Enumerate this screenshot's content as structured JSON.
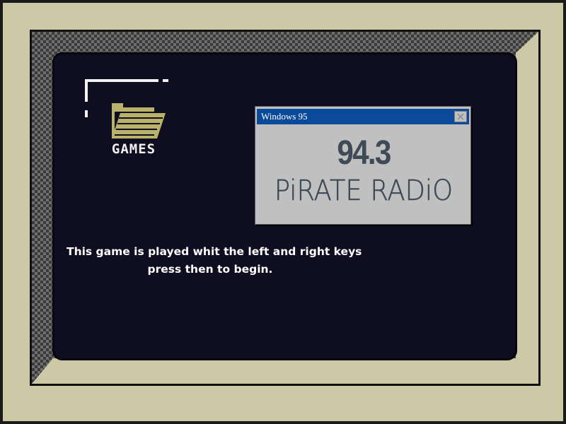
{
  "desktop": {
    "games_label": "GAMES",
    "folder_icon": "folder-icon",
    "folder_color": "#b9b26b"
  },
  "dialog": {
    "title": "Windows 95",
    "close_icon": "close-icon",
    "frequency": "94.3",
    "station_name": "PiRATE RADiO"
  },
  "instructions": {
    "line1": "This game is played whit the left and right keys",
    "line2": "press then to begin."
  },
  "colors": {
    "frame": "#cdc8a5",
    "screen": "#0f0d20",
    "titlebar": "#0a4a9a",
    "dialog": "#c0c0c0",
    "dialog_text": "#3e4a56"
  }
}
